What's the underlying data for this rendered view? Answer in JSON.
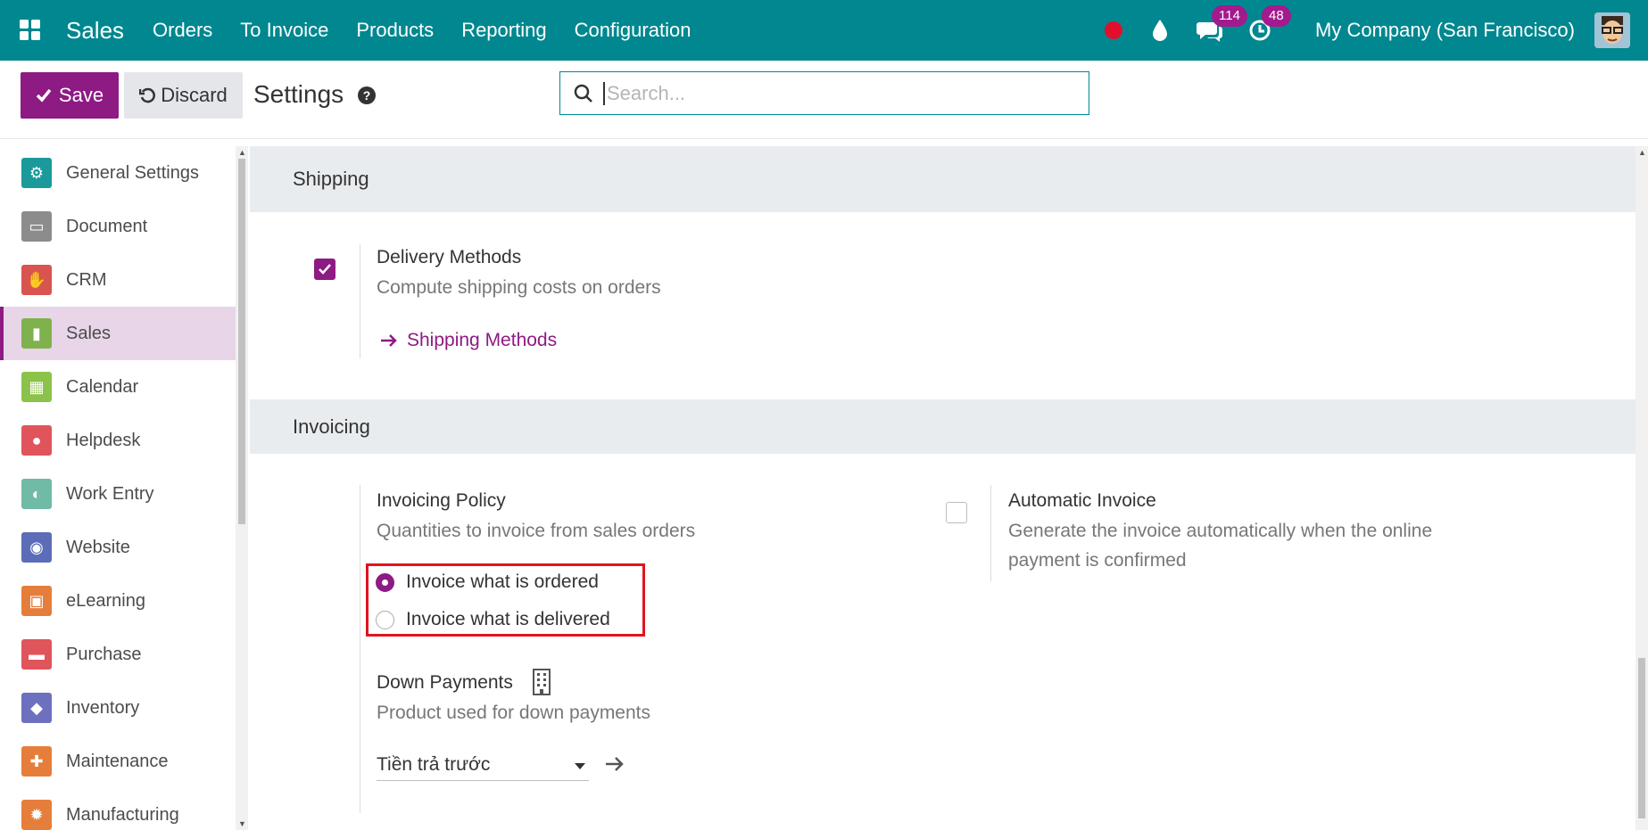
{
  "navbar": {
    "brand": "Sales",
    "menu": [
      "Orders",
      "To Invoice",
      "Products",
      "Reporting",
      "Configuration"
    ],
    "messages_count": "114",
    "activities_count": "48",
    "company": "My Company (San Francisco)"
  },
  "control": {
    "save_label": "Save",
    "discard_label": "Discard",
    "title": "Settings",
    "search_placeholder": "Search..."
  },
  "sidebar": {
    "items": [
      {
        "label": "General Settings",
        "icon": "gear-icon",
        "color": "#1a9a9a"
      },
      {
        "label": "Document",
        "icon": "folder-icon",
        "color": "#8c8c8c"
      },
      {
        "label": "CRM",
        "icon": "handshake-icon",
        "color": "#d9534f"
      },
      {
        "label": "Sales",
        "icon": "chart-icon",
        "color": "#7fb24d"
      },
      {
        "label": "Calendar",
        "icon": "calendar-icon",
        "color": "#8bc34a"
      },
      {
        "label": "Helpdesk",
        "icon": "helpdesk-icon",
        "color": "#e0545b"
      },
      {
        "label": "Work Entry",
        "icon": "work-entry-icon",
        "color": "#6fbba5"
      },
      {
        "label": "Website",
        "icon": "globe-icon",
        "color": "#5b6db8"
      },
      {
        "label": "eLearning",
        "icon": "elearning-icon",
        "color": "#e67e3b"
      },
      {
        "label": "Purchase",
        "icon": "credit-card-icon",
        "color": "#e0545b"
      },
      {
        "label": "Inventory",
        "icon": "box-icon",
        "color": "#6d6fbf"
      },
      {
        "label": "Maintenance",
        "icon": "maintenance-icon",
        "color": "#e67e3b"
      },
      {
        "label": "Manufacturing",
        "icon": "manufacturing-icon",
        "color": "#e67e3b"
      }
    ],
    "active": "Sales"
  },
  "shipping": {
    "header": "Shipping",
    "delivery_title": "Delivery Methods",
    "delivery_desc": "Compute shipping costs on orders",
    "delivery_checked": true,
    "link_label": "Shipping Methods"
  },
  "invoicing": {
    "header": "Invoicing",
    "policy_title": "Invoicing Policy",
    "policy_desc": "Quantities to invoice from sales orders",
    "option_ordered": "Invoice what is ordered",
    "option_delivered": "Invoice what is delivered",
    "selected_option": "Invoice what is ordered",
    "auto_title": "Automatic Invoice",
    "auto_desc_line1": "Generate the invoice automatically when the online",
    "auto_desc_line2": "payment is confirmed",
    "auto_checked": false,
    "down_title": "Down Payments",
    "down_desc": "Product used for down payments",
    "down_value": "Tiền trả trước"
  },
  "colors": {
    "navbar": "#00878f",
    "primary": "#8e1a84",
    "highlight": "#e0141e"
  }
}
